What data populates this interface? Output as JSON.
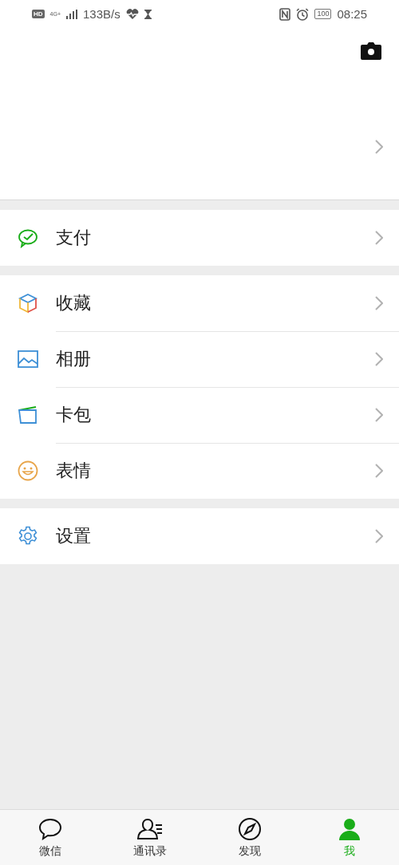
{
  "status_bar": {
    "hd": "HD",
    "network": "4G+",
    "speed": "133B/s",
    "battery": "100",
    "time": "08:25"
  },
  "sections": [
    {
      "items": [
        {
          "kind": "pay",
          "label": "支付"
        }
      ]
    },
    {
      "items": [
        {
          "kind": "favorites",
          "label": "收藏"
        },
        {
          "kind": "album",
          "label": "相册"
        },
        {
          "kind": "cards",
          "label": "卡包"
        },
        {
          "kind": "sticker",
          "label": "表情"
        }
      ]
    },
    {
      "items": [
        {
          "kind": "settings",
          "label": "设置"
        }
      ]
    }
  ],
  "tabs": [
    {
      "kind": "chat",
      "label": "微信",
      "selected": false
    },
    {
      "kind": "contacts",
      "label": "通讯录",
      "selected": false
    },
    {
      "kind": "discover",
      "label": "发现",
      "selected": false
    },
    {
      "kind": "me",
      "label": "我",
      "selected": true
    }
  ]
}
